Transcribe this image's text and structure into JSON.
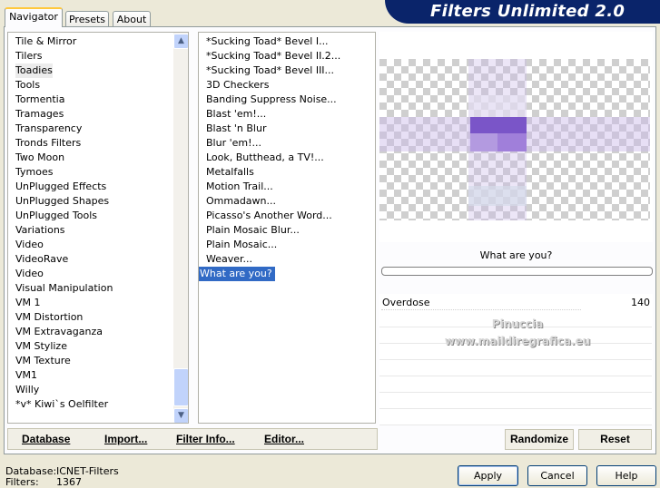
{
  "tabs": [
    {
      "label": "Navigator",
      "active": true
    },
    {
      "label": "Presets",
      "active": false
    },
    {
      "label": "About",
      "active": false
    }
  ],
  "app_title": "Filters Unlimited 2.0",
  "categories": [
    "Tile & Mirror",
    "Tilers",
    "Toadies",
    "Tools",
    "Tormentia",
    "Tramages",
    "Transparency",
    "Tronds Filters",
    "Two Moon",
    "Tymoes",
    "UnPlugged Effects",
    "UnPlugged Shapes",
    "UnPlugged Tools",
    "Variations",
    "Video",
    "VideoRave",
    "Video",
    "Visual Manipulation",
    "VM 1",
    "VM Distortion",
    "VM Extravaganza",
    "VM Stylize",
    "VM Texture",
    "VM1",
    "Willy",
    "*v* Kiwi`s Oelfilter"
  ],
  "selected_category": "Toadies",
  "filters": [
    "*Sucking Toad*  Bevel I...",
    "*Sucking Toad*  Bevel II.2...",
    "*Sucking Toad*  Bevel III...",
    "3D Checkers",
    "Banding Suppress Noise...",
    "Blast 'em!...",
    "Blast 'n Blur",
    "Blur 'em!...",
    "Look, Butthead, a TV!...",
    "Metalfalls",
    "Motion Trail...",
    "Ommadawn...",
    "Picasso's Another Word...",
    "Plain Mosaic Blur...",
    "Plain Mosaic...",
    "Weaver...",
    "What are you?"
  ],
  "selected_filter": "What are you?",
  "filter_name_display": "What are you?",
  "param": {
    "label": "Overdose",
    "value": "140"
  },
  "watermark": {
    "line1": "Pinuccia",
    "line2": "www.maildiregrafica.eu"
  },
  "links": {
    "database": "Database",
    "import": "Import...",
    "filter_info": "Filter Info...",
    "editor": "Editor..."
  },
  "buttons": {
    "randomize": "Randomize",
    "reset": "Reset",
    "apply": "Apply",
    "cancel": "Cancel",
    "help": "Help"
  },
  "status": {
    "database_label": "Database:",
    "database_value": "ICNET-Filters",
    "filters_label": "Filters:",
    "filters_value": "1367"
  },
  "icons": {
    "scroll_up": "up-arrow-icon",
    "scroll_down": "down-arrow-icon"
  }
}
